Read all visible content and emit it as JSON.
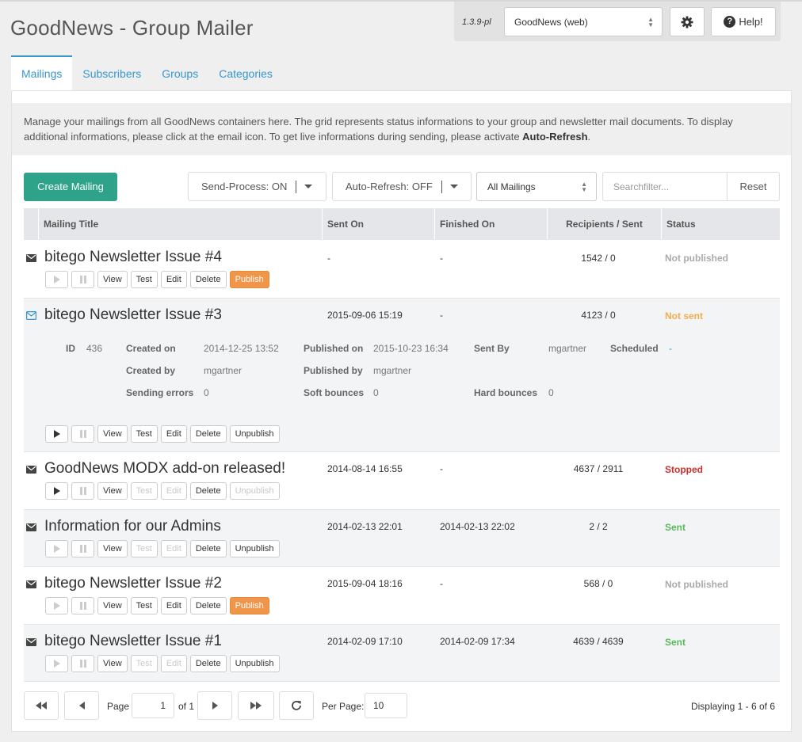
{
  "app": {
    "title": "GoodNews - Group Mailer",
    "version": "1.3.9-pl",
    "container_select": "GoodNews (web)",
    "help_label": "Help!"
  },
  "tabs": [
    {
      "label": "Mailings",
      "active": true
    },
    {
      "label": "Subscribers",
      "active": false
    },
    {
      "label": "Groups",
      "active": false
    },
    {
      "label": "Categories",
      "active": false
    }
  ],
  "description": {
    "line1": "Manage your mailings from all GoodNews containers here. The grid represents status informations to your group and newsletter mail documents. To display",
    "line2": "additional informations, please click at the email icon. To get live informations during sending, please activate ",
    "bold": "Auto-Refresh",
    "end": "."
  },
  "toolbar": {
    "create_label": "Create Mailing",
    "send_process": "Send-Process: ON",
    "auto_refresh": "Auto-Refresh: OFF",
    "filter_select": "All Mailings",
    "search_placeholder": "Searchfilter...",
    "reset_label": "Reset"
  },
  "grid": {
    "columns": [
      "Mailing Title",
      "Sent On",
      "Finished On",
      "Recipients / Sent",
      "Status"
    ],
    "rows": [
      {
        "title": "bitego Newsletter Issue #4",
        "sent_on": "-",
        "finished_on": "-",
        "recipients": "1542 / 0",
        "status": "Not published",
        "status_color": "#aaaaaa",
        "buttons": [
          "View",
          "Test",
          "Edit",
          "Delete",
          "Publish"
        ]
      },
      {
        "title": "bitego Newsletter Issue #3",
        "sent_on": "2015-09-06 15:19",
        "finished_on": "-",
        "recipients": "4123 / 0",
        "status": "Not sent",
        "status_color": "#f0ad4e",
        "buttons": [
          "View",
          "Test",
          "Edit",
          "Delete",
          "Unpublish"
        ]
      },
      {
        "title": "GoodNews MODX add-on released!",
        "sent_on": "2014-08-14 16:55",
        "finished_on": "-",
        "recipients": "4637 / 2911",
        "status": "Stopped",
        "status_color": "#c9302c",
        "buttons": [
          "View",
          "Test",
          "Edit",
          "Delete",
          "Unpublish"
        ]
      },
      {
        "title": "Information for our Admins",
        "sent_on": "2014-02-13 22:01",
        "finished_on": "2014-02-13 22:02",
        "recipients": "2 / 2",
        "status": "Sent",
        "status_color": "#5cb85c",
        "buttons": [
          "View",
          "Test",
          "Edit",
          "Delete",
          "Unpublish"
        ]
      },
      {
        "title": "bitego Newsletter Issue #2",
        "sent_on": "2015-09-04 18:16",
        "finished_on": "-",
        "recipients": "568 / 0",
        "status": "Not published",
        "status_color": "#aaaaaa",
        "buttons": [
          "View",
          "Test",
          "Edit",
          "Delete",
          "Publish"
        ]
      },
      {
        "title": "bitego Newsletter Issue #1",
        "sent_on": "2014-02-09 17:10",
        "finished_on": "2014-02-09 17:34",
        "recipients": "4639 / 4639",
        "status": "Sent",
        "status_color": "#5cb85c",
        "buttons": [
          "View",
          "Test",
          "Edit",
          "Delete",
          "Unpublish"
        ]
      }
    ],
    "details": {
      "id_label": "ID",
      "id": "436",
      "created_on_label": "Created on",
      "created_on": "2014-12-25 13:52",
      "published_on_label": "Published on",
      "published_on": "2015-10-23 16:34",
      "sent_by_label": "Sent By",
      "sent_by": "mgartner",
      "scheduled_label": "Scheduled",
      "scheduled": "-",
      "created_by_label": "Created by",
      "created_by": "mgartner",
      "published_by_label": "Published by",
      "published_by": "mgartner",
      "sending_errors_label": "Sending errors",
      "sending_errors": "0",
      "soft_bounces_label": "Soft bounces",
      "soft_bounces": "0",
      "hard_bounces_label": "Hard bounces",
      "hard_bounces": "0"
    }
  },
  "pager": {
    "page_label": "Page",
    "page": "1",
    "of_label": "of 1",
    "per_page_label": "Per Page:",
    "per_page": "10",
    "displaying": "Displaying 1 - 6 of 6"
  }
}
